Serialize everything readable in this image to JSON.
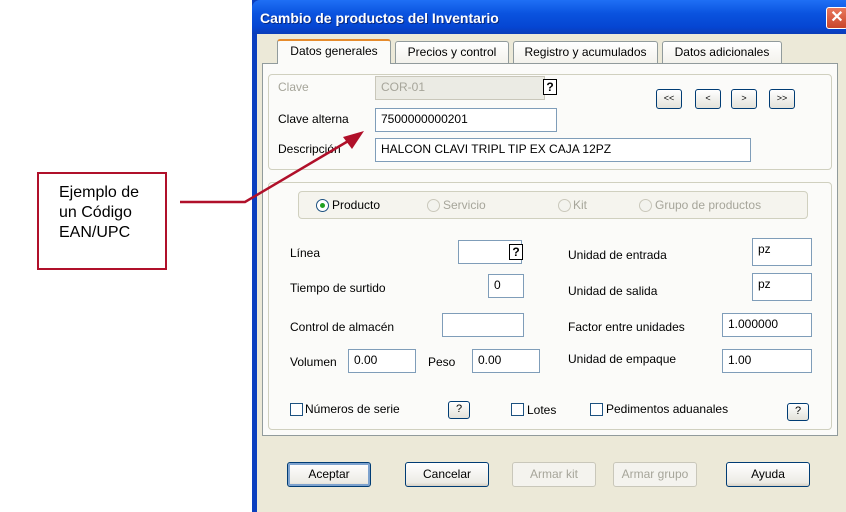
{
  "annotation": {
    "lines": [
      "Ejemplo de",
      "un Código",
      "EAN/UPC"
    ],
    "color": "#b0102a"
  },
  "window": {
    "title": "Cambio de productos del Inventario",
    "close_symbol": "✕"
  },
  "tabs": [
    {
      "label": "Datos generales",
      "active": true
    },
    {
      "label": "Precios y control",
      "active": false
    },
    {
      "label": "Registro y acumulados",
      "active": false
    },
    {
      "label": "Datos adicionales",
      "active": false
    }
  ],
  "header": {
    "clave_label": "Clave",
    "clave_value": "COR-01",
    "clave_alterna_label": "Clave alterna",
    "clave_alterna_value": "7500000000201",
    "descripcion_label": "Descripción",
    "descripcion_value": "HALCON CLAVI TRIPL TIP EX CAJA 12PZ",
    "lookup_symbol": "?"
  },
  "nav": {
    "first": "<<",
    "prev": "<",
    "next": ">",
    "last": ">>"
  },
  "tipo": {
    "producto": "Producto",
    "servicio": "Servicio",
    "kit": "Kit",
    "grupo": "Grupo de productos",
    "selected": "Producto"
  },
  "form": {
    "linea_label": "Línea",
    "linea_value": "",
    "tiempo_label": "Tiempo de surtido",
    "tiempo_value": "0",
    "control_label": "Control de almacén",
    "control_value": "",
    "volumen_label": "Volumen",
    "volumen_value": "0.00",
    "peso_label": "Peso",
    "peso_value": "0.00",
    "unidad_entrada_label": "Unidad de entrada",
    "unidad_entrada_value": "pz",
    "unidad_salida_label": "Unidad de salida",
    "unidad_salida_value": "pz",
    "factor_label": "Factor entre unidades",
    "factor_value": "1.000000",
    "empaque_label": "Unidad de empaque",
    "empaque_value": "1.00"
  },
  "checks": {
    "series_label": "Números de serie",
    "lotes_label": "Lotes",
    "pedimentos_label": "Pedimentos aduanales",
    "help_symbol": "?"
  },
  "buttons": {
    "aceptar": "Aceptar",
    "cancelar": "Cancelar",
    "armar_kit": "Armar kit",
    "armar_grupo": "Armar grupo",
    "ayuda": "Ayuda"
  }
}
